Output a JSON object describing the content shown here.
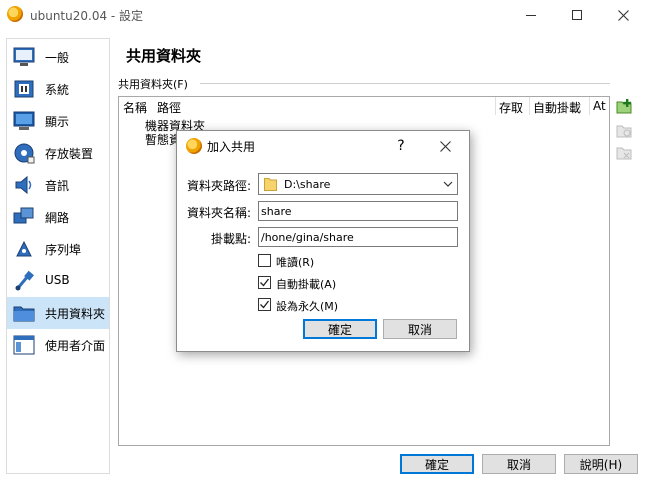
{
  "window": {
    "title": "ubuntu20.04 - 設定"
  },
  "sidebar": {
    "items": [
      {
        "label": "一般",
        "icon": "monitor-icon"
      },
      {
        "label": "系統",
        "icon": "chip-icon"
      },
      {
        "label": "顯示",
        "icon": "display-icon"
      },
      {
        "label": "存放裝置",
        "icon": "disk-icon"
      },
      {
        "label": "音訊",
        "icon": "speaker-icon"
      },
      {
        "label": "網路",
        "icon": "network-icon"
      },
      {
        "label": "序列埠",
        "icon": "serial-port-icon"
      },
      {
        "label": "USB",
        "icon": "usb-icon"
      },
      {
        "label": "共用資料夾",
        "icon": "folder-icon"
      },
      {
        "label": "使用者介面",
        "icon": "ui-window-icon"
      }
    ],
    "selected_index": 8
  },
  "main": {
    "title": "共用資料夾",
    "group_label": "共用資料夾(F)",
    "columns": [
      "名稱",
      "路徑",
      "存取",
      "自動掛載",
      "At"
    ],
    "rows": [
      "機器資料夾",
      "暫態資"
    ]
  },
  "buttons": {
    "ok": "確定",
    "cancel": "取消",
    "help": "說明(H)"
  },
  "dialog": {
    "title": "加入共用",
    "help_glyph": "?",
    "path_label": "資料夾路徑:",
    "path_value": "D:\\share",
    "name_label": "資料夾名稱:",
    "name_value": "share",
    "mount_label": "掛載點:",
    "mount_value": "/hone/gina/share",
    "readonly_label": "唯讀(R)",
    "readonly_checked": false,
    "automount_label": "自動掛載(A)",
    "automount_checked": true,
    "permanent_label": "設為永久(M)",
    "permanent_checked": true,
    "ok": "確定",
    "cancel": "取消"
  },
  "colors": {
    "accent": "#0078d7",
    "selection": "#cce4f7",
    "folder": "#f6d46b"
  }
}
